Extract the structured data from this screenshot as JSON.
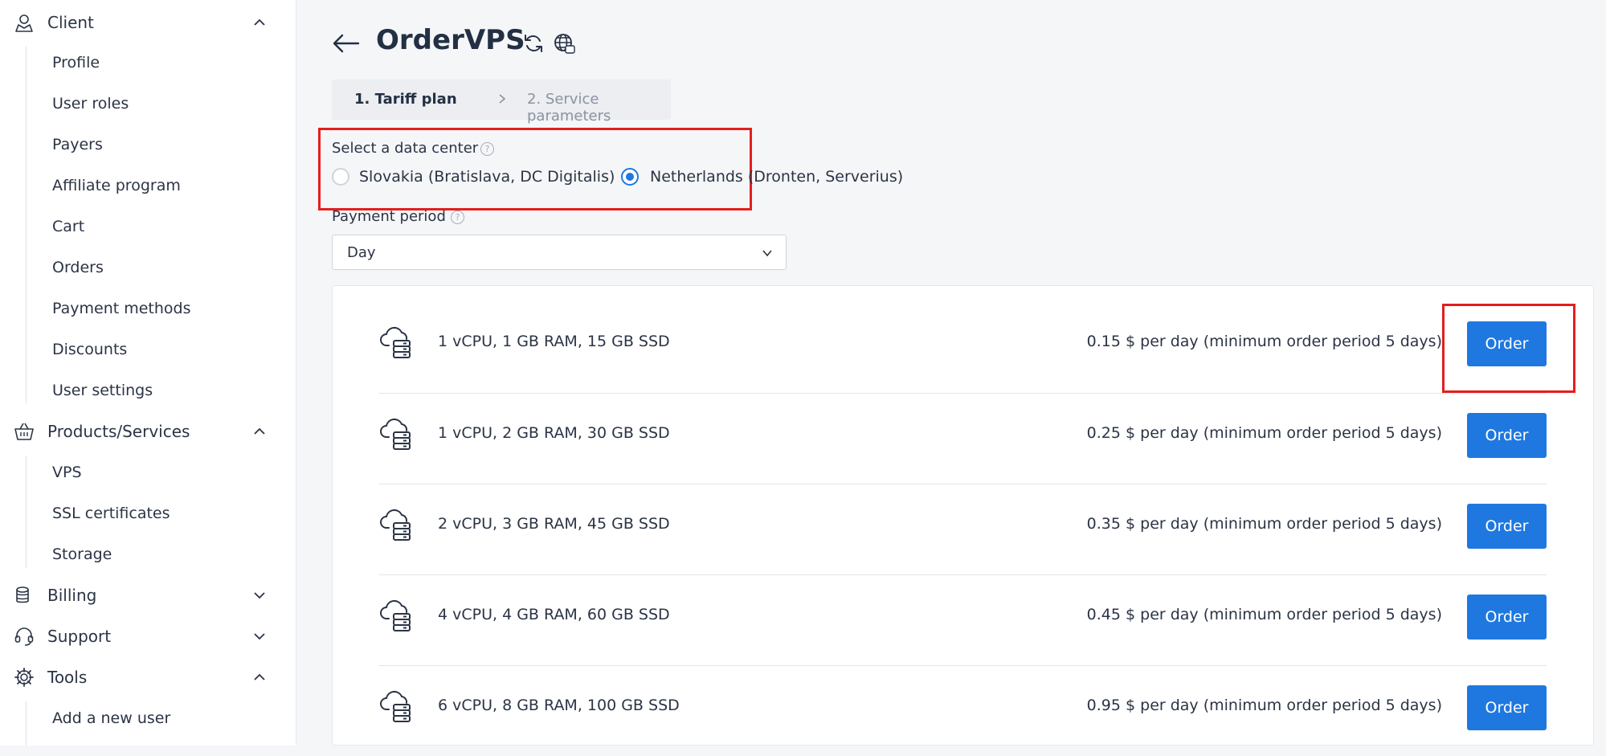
{
  "sidebar": {
    "client": {
      "label": "Client",
      "items": [
        "Profile",
        "User roles",
        "Payers",
        "Affiliate program",
        "Cart",
        "Orders",
        "Payment methods",
        "Discounts",
        "User settings"
      ]
    },
    "products": {
      "label": "Products/Services",
      "items": [
        "VPS",
        "SSL certificates",
        "Storage"
      ]
    },
    "billing": {
      "label": "Billing"
    },
    "support": {
      "label": "Support"
    },
    "tools": {
      "label": "Tools",
      "items": [
        "Add a new user"
      ]
    }
  },
  "header": {
    "title": "OrderVPS",
    "back_icon": "arrow-left-icon",
    "refresh_icon": "refresh-icon",
    "globe_icon": "globe-icon"
  },
  "steps": {
    "step1": "1. Tariff plan",
    "step2": "2. Service parameters"
  },
  "datacenter": {
    "label": "Select a data center",
    "options": [
      {
        "label": "Slovakia (Bratislava, DC Digitalis)",
        "selected": false
      },
      {
        "label": "Netherlands (Dronten, Serverius)",
        "selected": true
      }
    ]
  },
  "payment_period": {
    "label": "Payment period",
    "value": "Day"
  },
  "help_glyph": "?",
  "plans": [
    {
      "name": "1 vCPU, 1 GB RAM, 15 GB SSD",
      "price": "0.15 $ per day (minimum order period 5 days)",
      "button": "Order"
    },
    {
      "name": "1 vCPU, 2 GB RAM, 30 GB SSD",
      "price": "0.25 $ per day (minimum order period 5 days)",
      "button": "Order"
    },
    {
      "name": "2 vCPU, 3 GB RAM, 45 GB SSD",
      "price": "0.35 $ per day (minimum order period 5 days)",
      "button": "Order"
    },
    {
      "name": "4 vCPU, 4 GB RAM, 60 GB SSD",
      "price": "0.45 $ per day (minimum order period 5 days)",
      "button": "Order"
    },
    {
      "name": "6 vCPU, 8 GB RAM, 100 GB SSD",
      "price": "0.95 $ per day (minimum order period 5 days)",
      "button": "Order"
    }
  ],
  "colors": {
    "accent": "#1f78e0",
    "highlight": "#e41e1e",
    "text": "#2b3445"
  }
}
